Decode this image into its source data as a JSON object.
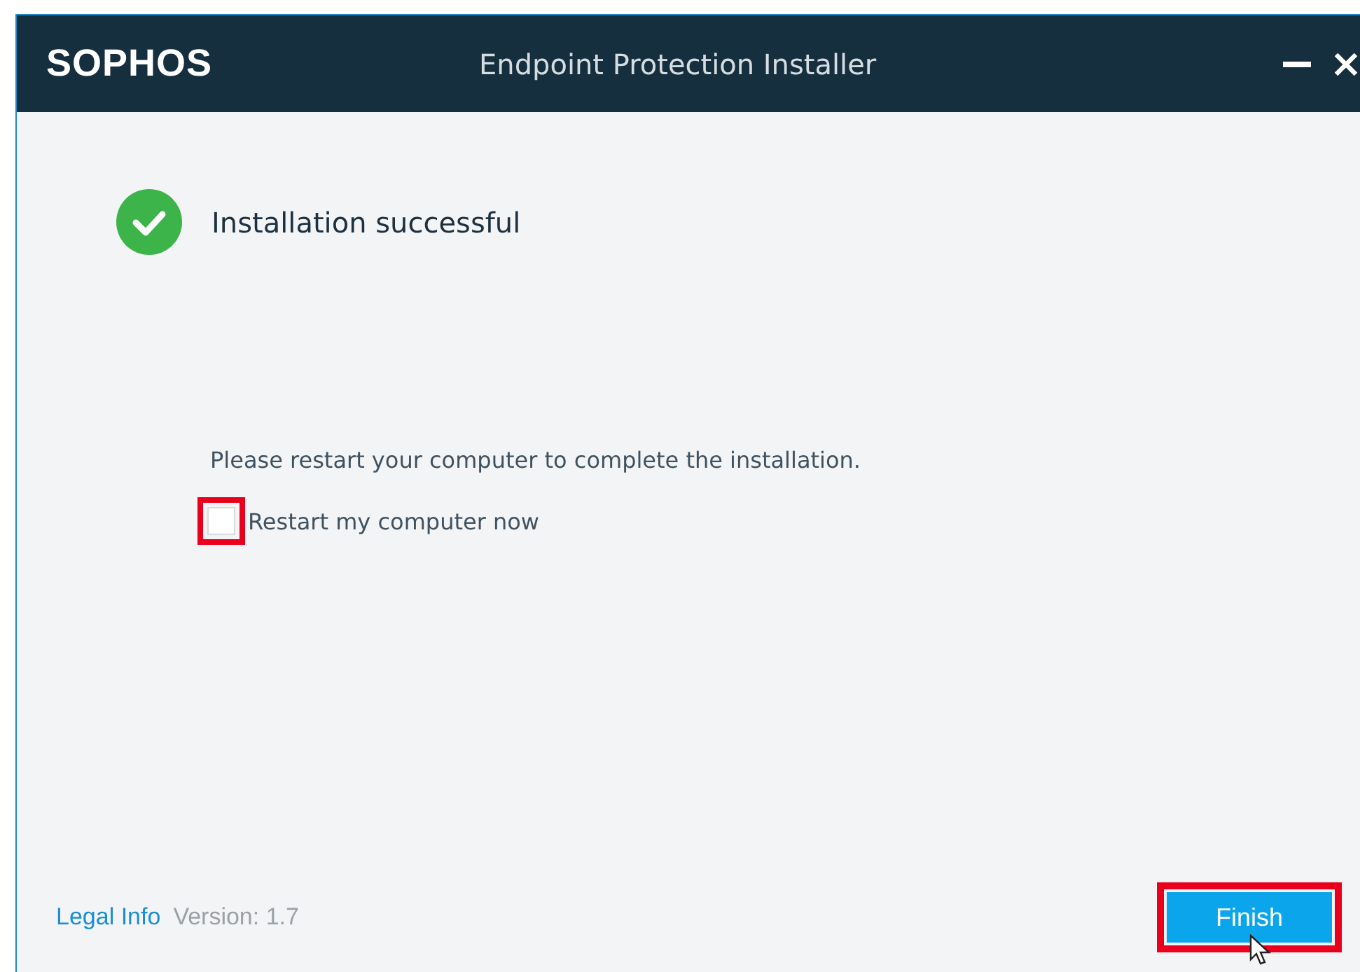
{
  "window": {
    "brand": "SOPHOS",
    "title": "Endpoint Protection Installer"
  },
  "status": {
    "heading": "Installation successful",
    "success": true
  },
  "message": "Please restart your computer to complete the installation.",
  "restart_option": {
    "label": "Restart my computer now",
    "checked": false,
    "highlighted": true
  },
  "footer": {
    "link": "Legal Info",
    "version": "Version: 1.7"
  },
  "finish_button": {
    "label": "Finish",
    "highlighted": true
  }
}
